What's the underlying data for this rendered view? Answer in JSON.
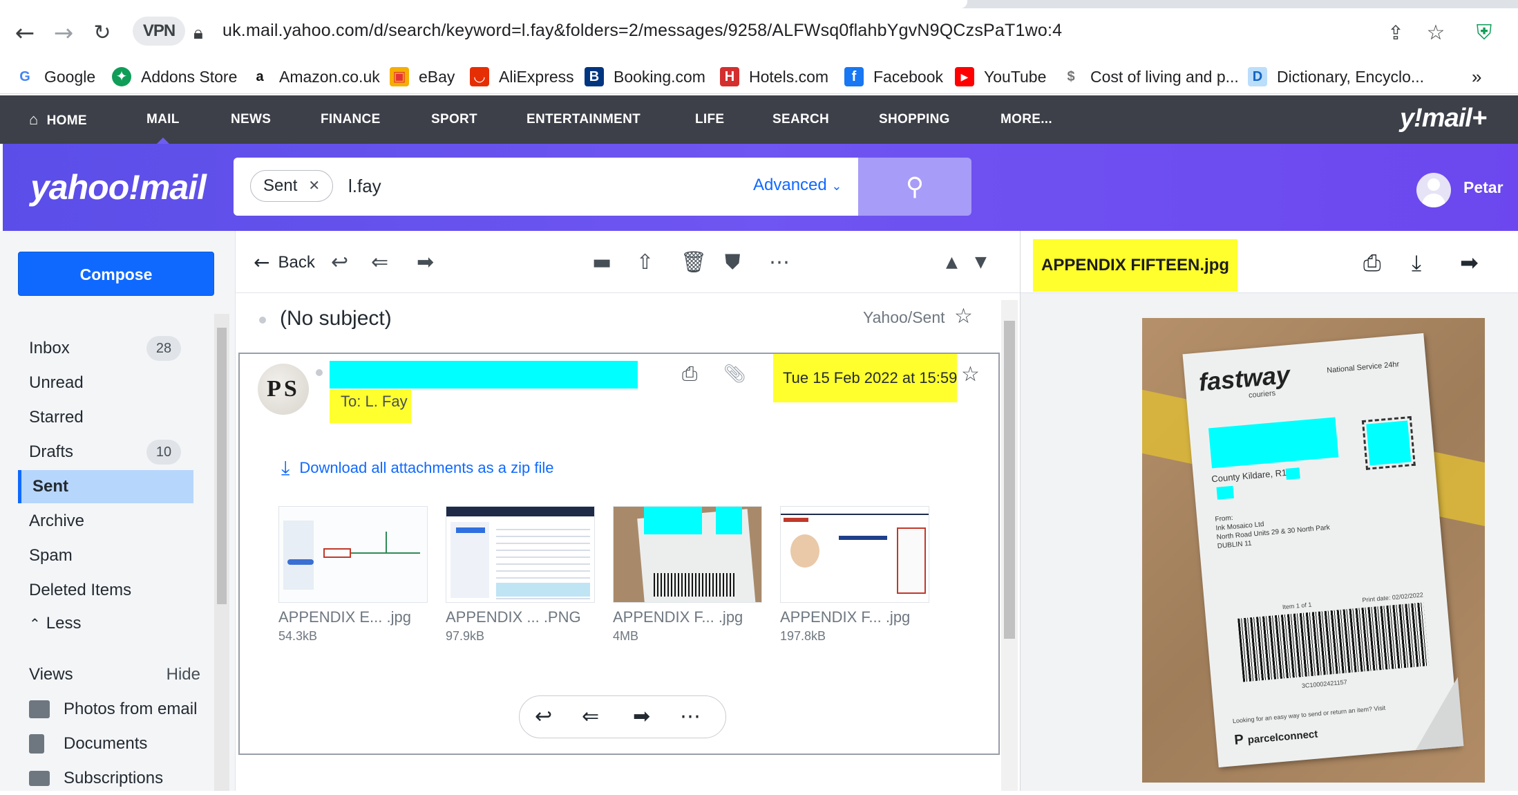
{
  "browser": {
    "url": "uk.mail.yahoo.com/d/search/keyword=l.fay&folders=2/messages/9258/ALFWsq0flahbYgvN9QCzsPaT1wo:4",
    "vpn_label": "VPN",
    "bookmarks": [
      {
        "label": "Google",
        "icon": "google-icon",
        "color": "#4285f4"
      },
      {
        "label": "Addons Store",
        "icon": "puzzle-icon",
        "color": "#0f9d58"
      },
      {
        "label": "Amazon.co.uk",
        "icon": "amazon-icon",
        "color": "#232f3e"
      },
      {
        "label": "eBay",
        "icon": "bag-icon",
        "color": "#e53238"
      },
      {
        "label": "AliExpress",
        "icon": "aliexpress-icon",
        "color": "#e62e04"
      },
      {
        "label": "Booking.com",
        "icon": "booking-icon",
        "color": "#003580"
      },
      {
        "label": "Hotels.com",
        "icon": "hotels-icon",
        "color": "#d32f2f"
      },
      {
        "label": "Facebook",
        "icon": "facebook-icon",
        "color": "#1877f2"
      },
      {
        "label": "YouTube",
        "icon": "youtube-icon",
        "color": "#ff0000"
      },
      {
        "label": "Cost of living and p...",
        "icon": "money-icon",
        "color": "#9e9e9e"
      },
      {
        "label": "Dictionary, Encyclo...",
        "icon": "dictionary-icon",
        "color": "#1565c0"
      }
    ],
    "more_bookmarks": "»"
  },
  "yahoo_nav": {
    "items": [
      "HOME",
      "MAIL",
      "NEWS",
      "FINANCE",
      "SPORT",
      "ENTERTAINMENT",
      "LIFE",
      "SEARCH",
      "SHOPPING",
      "MORE..."
    ],
    "active": "MAIL",
    "brand": "y!mail+"
  },
  "header": {
    "logo": "yahoo!mail",
    "search_chip": "Sent",
    "search_text": "l.fay",
    "advanced_label": "Advanced",
    "user_name": "Petar"
  },
  "sidebar": {
    "compose_label": "Compose",
    "folders": [
      {
        "label": "Inbox",
        "count": "28"
      },
      {
        "label": "Unread",
        "count": ""
      },
      {
        "label": "Starred",
        "count": ""
      },
      {
        "label": "Drafts",
        "count": "10"
      },
      {
        "label": "Sent",
        "count": "",
        "selected": true
      },
      {
        "label": "Archive",
        "count": ""
      },
      {
        "label": "Spam",
        "count": ""
      },
      {
        "label": "Deleted Items",
        "count": ""
      }
    ],
    "less_label": "Less",
    "views_label": "Views",
    "hide_label": "Hide",
    "views": [
      {
        "label": "Photos from email",
        "icon": "photos-icon"
      },
      {
        "label": "Documents",
        "icon": "document-icon"
      },
      {
        "label": "Subscriptions",
        "icon": "subscriptions-icon"
      }
    ]
  },
  "email": {
    "back_label": "Back",
    "subject": "(No subject)",
    "folder_label": "Yahoo/Sent",
    "sender_initials": "PS",
    "to": "To: L. Fay",
    "date": "Tue 15 Feb 2022 at 15:59",
    "download_all": "Download all attachments as a zip file",
    "attachments": [
      {
        "name": "APPENDIX E... .jpg",
        "size": "54.3kB"
      },
      {
        "name": "APPENDIX ... .PNG",
        "size": "97.9kB"
      },
      {
        "name": "APPENDIX F... .jpg",
        "size": "4MB"
      },
      {
        "name": "APPENDIX F... .jpg",
        "size": "197.8kB"
      }
    ]
  },
  "preview": {
    "title": "APPENDIX FIFTEEN.jpg",
    "label_brand": "fastway",
    "label_brand_sub": "couriers",
    "label_service": "National Service 24hr",
    "label_county": "County Kildare, R14",
    "label_from_lines": [
      "From:",
      "Ink Mosaico Ltd",
      "North Road  Units 29 & 30 North Park",
      "DUBLIN 11"
    ],
    "label_item": "Item 1 of 1",
    "label_print_date": "Print date: 02/02/2022",
    "label_barcode_no": "3C10002421157",
    "label_footer": "Looking for an easy way to send or return an item? Visit",
    "label_footer_brand": "parcelconnect"
  },
  "colors": {
    "yahoo_purple": "#6e55f0",
    "nav_dark": "#3d4049",
    "link_blue": "#0f69ff",
    "highlight_yellow": "#ffff2e",
    "redaction_cyan": "#00ffff"
  }
}
